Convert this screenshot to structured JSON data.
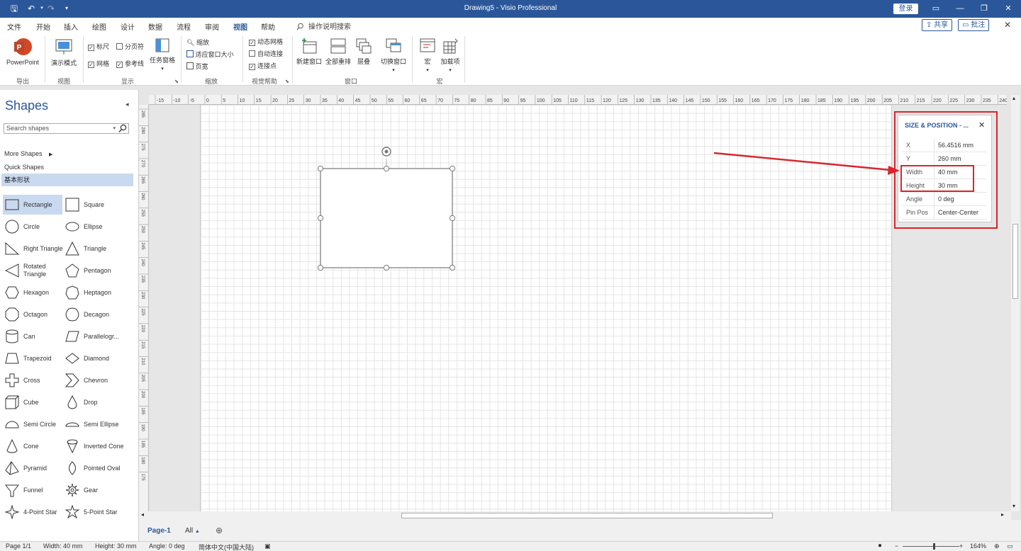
{
  "window": {
    "title": "Drawing5  -  Visio Professional",
    "login_label": "登录",
    "controls": [
      "ribbon-display-icon",
      "minimize-icon",
      "restore-icon",
      "close-icon"
    ]
  },
  "menu": {
    "items": [
      "文件",
      "开始",
      "插入",
      "绘图",
      "设计",
      "数据",
      "流程",
      "审阅",
      "视图",
      "帮助"
    ],
    "active": "视图",
    "tell_me": "操作说明搜索",
    "share_label": "共享",
    "comments_label": "批注"
  },
  "ribbon": {
    "export": {
      "powerpoint_label": "PowerPoint",
      "group": "导出"
    },
    "views": {
      "presentation_label": "演示模式",
      "group": "视图"
    },
    "show": {
      "ruler": "标尺",
      "page_breaks": "分页符",
      "grid": "网格",
      "guides": "参考线",
      "task_panes": "任务窗格",
      "group": "显示"
    },
    "zoom": {
      "zoom": "缩放",
      "fit_window": "适应窗口大小",
      "page_width": "页宽",
      "group": "缩放"
    },
    "visual_aids": {
      "dynamic_grid": "动态网格",
      "autoconnect": "自动连接",
      "connection_points": "连接点",
      "group": "视觉帮助"
    },
    "window": {
      "new_window": "新建窗口",
      "arrange_all": "全部重排",
      "cascade": "层叠",
      "switch_windows": "切换窗口",
      "group": "窗口"
    },
    "macros": {
      "macros": "宏",
      "addins": "加载项",
      "group": "宏"
    }
  },
  "shapes_panel": {
    "title": "Shapes",
    "search_placeholder": "Search shapes",
    "more_shapes": "More Shapes",
    "quick_shapes": "Quick Shapes",
    "stencil": "基本形状",
    "items": [
      {
        "name": "Rectangle",
        "icon": "rectangle",
        "selected": true
      },
      {
        "name": "Square",
        "icon": "square"
      },
      {
        "name": "Circle",
        "icon": "circle"
      },
      {
        "name": "Ellipse",
        "icon": "ellipse"
      },
      {
        "name": "Right Triangle",
        "icon": "right-triangle"
      },
      {
        "name": "Triangle",
        "icon": "triangle"
      },
      {
        "name": "Rotated Triangle",
        "icon": "rotated-triangle"
      },
      {
        "name": "Pentagon",
        "icon": "pentagon"
      },
      {
        "name": "Hexagon",
        "icon": "hexagon"
      },
      {
        "name": "Heptagon",
        "icon": "heptagon"
      },
      {
        "name": "Octagon",
        "icon": "octagon"
      },
      {
        "name": "Decagon",
        "icon": "decagon"
      },
      {
        "name": "Can",
        "icon": "can"
      },
      {
        "name": "Parallelogr...",
        "icon": "parallelogram"
      },
      {
        "name": "Trapezoid",
        "icon": "trapezoid"
      },
      {
        "name": "Diamond",
        "icon": "diamond"
      },
      {
        "name": "Cross",
        "icon": "cross"
      },
      {
        "name": "Chevron",
        "icon": "chevron"
      },
      {
        "name": "Cube",
        "icon": "cube"
      },
      {
        "name": "Drop",
        "icon": "drop"
      },
      {
        "name": "Semi Circle",
        "icon": "semi-circle"
      },
      {
        "name": "Semi Ellipse",
        "icon": "semi-ellipse"
      },
      {
        "name": "Cone",
        "icon": "cone"
      },
      {
        "name": "Inverted Cone",
        "icon": "inverted-cone"
      },
      {
        "name": "Pyramid",
        "icon": "pyramid"
      },
      {
        "name": "Pointed Oval",
        "icon": "pointed-oval"
      },
      {
        "name": "Funnel",
        "icon": "funnel"
      },
      {
        "name": "Gear",
        "icon": "gear"
      },
      {
        "name": "4-Point Star",
        "icon": "star4"
      },
      {
        "name": "5-Point Star",
        "icon": "star5"
      }
    ]
  },
  "rulers": {
    "horizontal": [
      "-15",
      "-10",
      "-5",
      "0",
      "5",
      "10",
      "15",
      "20",
      "25",
      "30",
      "35",
      "40",
      "45",
      "50",
      "55",
      "60",
      "65",
      "70",
      "75",
      "80",
      "85",
      "90",
      "95",
      "100",
      "105",
      "110",
      "115",
      "120",
      "125",
      "130",
      "135",
      "140",
      "145",
      "150",
      "155",
      "160",
      "165",
      "170",
      "175",
      "180",
      "185",
      "190",
      "195",
      "200",
      "205",
      "210",
      "215",
      "220",
      "225",
      "230",
      "235",
      "240"
    ],
    "vertical": [
      "285",
      "280",
      "275",
      "270",
      "265",
      "260",
      "255",
      "250",
      "245",
      "240",
      "235",
      "230",
      "225",
      "220",
      "215",
      "210",
      "205",
      "200",
      "195",
      "190",
      "185",
      "180",
      "175"
    ]
  },
  "size_position": {
    "title": "SIZE & POSITION - ...",
    "rows": [
      {
        "key": "X",
        "value": "56.4516 mm"
      },
      {
        "key": "Y",
        "value": "260 mm"
      },
      {
        "key": "Width",
        "value": "40 mm"
      },
      {
        "key": "Height",
        "value": "30 mm"
      },
      {
        "key": "Angle",
        "value": "0 deg"
      },
      {
        "key": "Pin Pos",
        "value": "Center-Center"
      }
    ]
  },
  "page_tabs": {
    "page": "Page-1",
    "all": "All"
  },
  "status": {
    "page": "Page 1/1",
    "width": "Width: 40 mm",
    "height": "Height: 30 mm",
    "angle": "Angle: 0 deg",
    "language": "简体中文(中国大陆)",
    "zoom": "164%"
  },
  "colors": {
    "brand": "#2b579a",
    "annotation": "#d9252b",
    "selection": "#c9d9f0"
  }
}
